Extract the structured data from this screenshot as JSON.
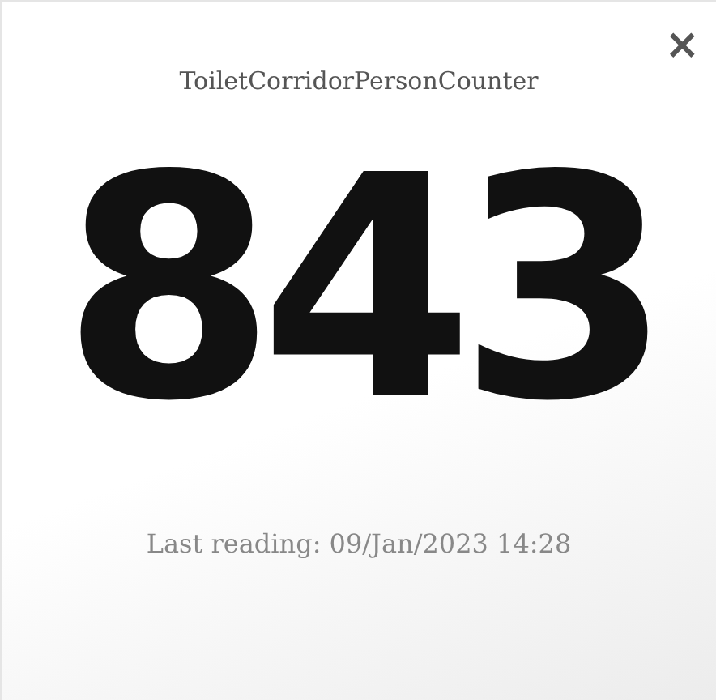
{
  "close_button": {
    "label": "×"
  },
  "title": "ToiletCorridorPersonCounter",
  "value": "843",
  "last_reading": "Last reading: 09/Jan/2023 14:28"
}
